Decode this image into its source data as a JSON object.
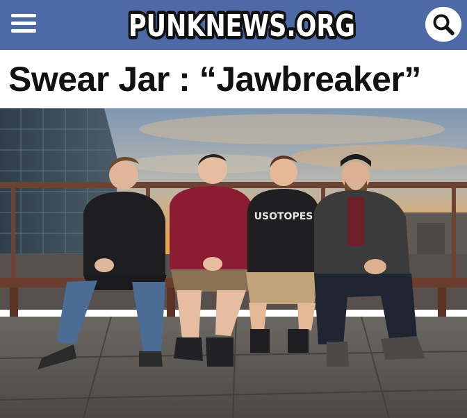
{
  "header": {
    "logo_text": "PUNKNEWS.ORG",
    "menu_icon": "hamburger-menu-icon",
    "search_icon": "magnifier-search-icon",
    "background_color": "#4d6aa6"
  },
  "article": {
    "title": "Swear Jar : “Jawbreaker”",
    "photo": {
      "subject": "band photo",
      "shirt_text": "USOTOPES"
    }
  }
}
